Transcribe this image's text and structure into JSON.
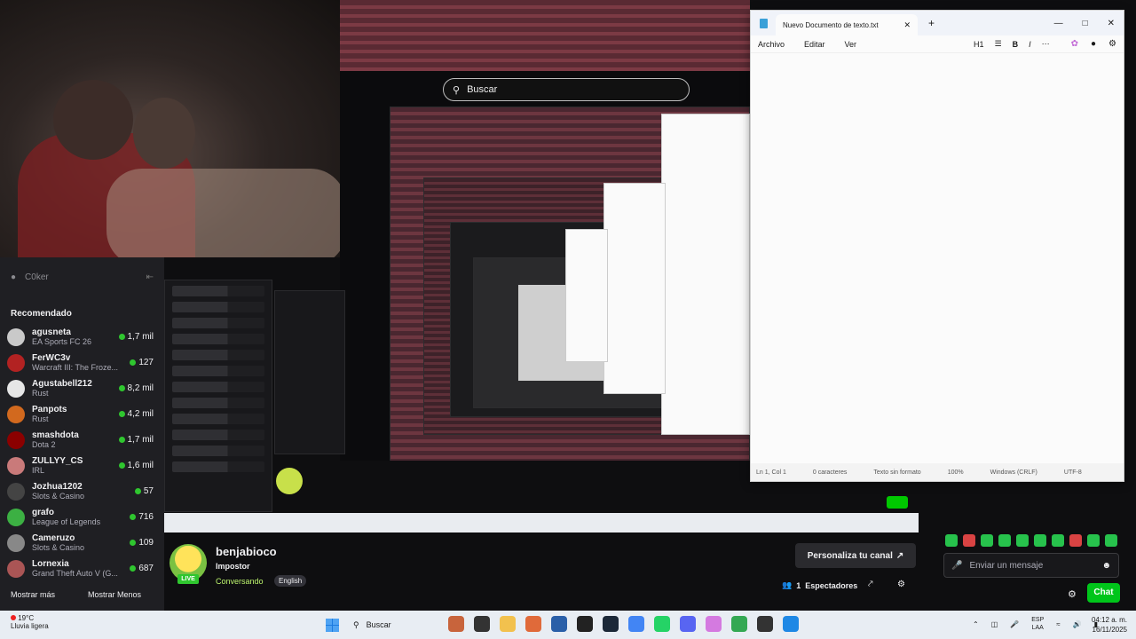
{
  "mirror": {
    "search_placeholder": "Buscar"
  },
  "sidebar": {
    "user": "C0ker",
    "heading": "Recomendado",
    "channels": [
      {
        "name": "agusneta",
        "game": "EA Sports FC 26",
        "viewers": "1,7 mil",
        "color": "#c9c9c9"
      },
      {
        "name": "FerWC3v",
        "game": "Warcraft III: The Froze...",
        "viewers": "127",
        "color": "#b22222"
      },
      {
        "name": "Agustabell212",
        "game": "Rust",
        "viewers": "8,2 mil",
        "color": "#e6e6e6"
      },
      {
        "name": "Panpots",
        "game": "Rust",
        "viewers": "4,2 mil",
        "color": "#d2691e"
      },
      {
        "name": "smashdota",
        "game": "Dota 2",
        "viewers": "1,7 mil",
        "color": "#8b0000"
      },
      {
        "name": "ZULLYY_CS",
        "game": "IRL",
        "viewers": "1,6 mil",
        "color": "#c97a7a"
      },
      {
        "name": "Jozhua1202",
        "game": "Slots & Casino",
        "viewers": "57",
        "color": "#444"
      },
      {
        "name": "grafo",
        "game": "League of Legends",
        "viewers": "716",
        "color": "#3cb043"
      },
      {
        "name": "Cameruzo",
        "game": "Slots & Casino",
        "viewers": "109",
        "color": "#888"
      },
      {
        "name": "Lornexia",
        "game": "Grand Theft Auto V (G...",
        "viewers": "687",
        "color": "#a55"
      }
    ],
    "show_more": "Mostrar más",
    "show_less": "Mostrar Menos"
  },
  "channel": {
    "name": "benjabioco",
    "title": "Impostor",
    "category": "Conversando",
    "tag": "English",
    "live": "LIVE",
    "customize": "Personaliza tu canal",
    "viewers_count": "1",
    "viewers_label": "Espectadores"
  },
  "chat": {
    "placeholder": "Enviar un mensaje",
    "button": "Chat"
  },
  "notepad": {
    "tab_title": "Nuevo Documento de texto.txt",
    "menus": [
      "Archivo",
      "Editar",
      "Ver"
    ],
    "heading_tool": "H1",
    "status": {
      "position": "Ln 1, Col 1",
      "chars": "0 caracteres",
      "format": "Texto sin formato",
      "zoom": "100%",
      "eol": "Windows (CRLF)",
      "encoding": "UTF-8"
    }
  },
  "taskbar": {
    "temp": "19°C",
    "weather": "Lluvia ligera",
    "search": "Buscar",
    "lang_top": "ESP",
    "lang_bottom": "LAA",
    "time": "04:12 a. m.",
    "date": "16/11/2025"
  }
}
